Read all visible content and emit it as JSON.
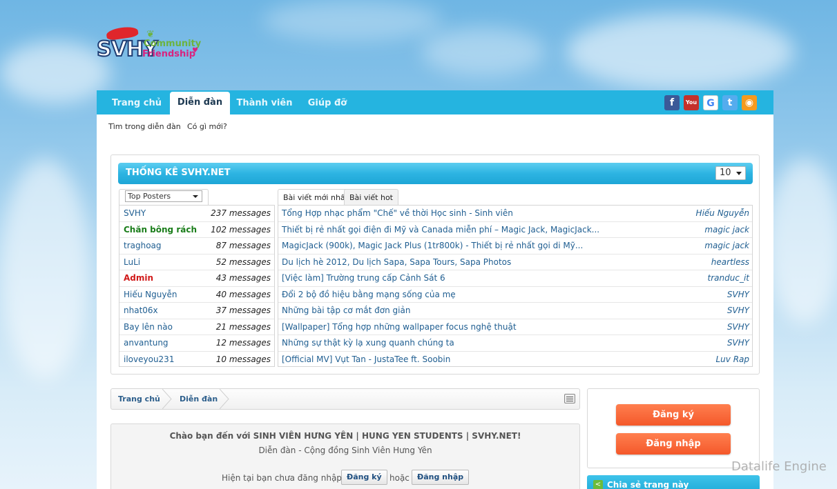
{
  "logo": {
    "text": "SVHY",
    "community": "Community",
    "friendship": "Friendship"
  },
  "nav": {
    "tabs": [
      {
        "label": "Trang chủ"
      },
      {
        "label": "Diễn đàn"
      },
      {
        "label": "Thành viên"
      },
      {
        "label": "Giúp đỡ"
      }
    ],
    "active_tab": "Diễn đàn",
    "social_icons": [
      "facebook-icon",
      "youtube-icon",
      "google-icon",
      "twitter-icon",
      "rss-icon"
    ]
  },
  "subnav": {
    "search": "Tìm trong diễn đàn",
    "whats_new": "Có gì mới?"
  },
  "stats": {
    "title": "THỐNG KÊ SVHY.NET",
    "count_value": "10",
    "poster_filter": "Top Posters",
    "posters": [
      {
        "name": "SVHY",
        "count": "237 messages",
        "style": "normal"
      },
      {
        "name": "Chăn bông rách",
        "count": "102 messages",
        "style": "green"
      },
      {
        "name": "traghoag",
        "count": "87 messages",
        "style": "normal"
      },
      {
        "name": "LuLi",
        "count": "52 messages",
        "style": "normal"
      },
      {
        "name": "Admin",
        "count": "43 messages",
        "style": "red"
      },
      {
        "name": "Hiếu Nguyễn",
        "count": "40 messages",
        "style": "normal"
      },
      {
        "name": "nhat06x",
        "count": "37 messages",
        "style": "normal"
      },
      {
        "name": "Bay lên nào",
        "count": "21 messages",
        "style": "normal"
      },
      {
        "name": "anvantung",
        "count": "12 messages",
        "style": "normal"
      },
      {
        "name": "iloveyou231",
        "count": "10 messages",
        "style": "normal"
      }
    ],
    "post_tabs": [
      {
        "label": "Bài viết mới nhất"
      },
      {
        "label": "Bài viết hot"
      }
    ],
    "posts": [
      {
        "title": "Tổng Hợp nhạc phẩm \"Chế\" về thời Học sinh - Sinh viên",
        "author": "Hiếu Nguyễn"
      },
      {
        "title": "Thiết bị rẻ nhất gọi điện đi Mỹ và Canada miễn phí – Magic Jack, MagicJack...",
        "author": "magic jack"
      },
      {
        "title": "MagicJack (900k), Magic Jack Plus (1tr800k) - Thiết bị rẻ nhất gọi di Mỹ...",
        "author": "magic jack"
      },
      {
        "title": "Du lịch hè 2012, Du lịch Sapa, Sapa Tours, Sapa Photos",
        "author": "heartless"
      },
      {
        "title": "[Việc làm] Trường trung cấp Cảnh Sát 6",
        "author": "tranduc_it"
      },
      {
        "title": "Đổi 2 bộ đồ hiệu bằng mạng sống của mẹ",
        "author": "SVHY"
      },
      {
        "title": "Những bài tập cơ mắt đơn giản",
        "author": "SVHY"
      },
      {
        "title": "[Wallpaper] Tổng hợp những wallpaper focus nghệ thuật",
        "author": "SVHY"
      },
      {
        "title": "Những sự thật kỳ lạ xung quanh chúng ta",
        "author": "SVHY"
      },
      {
        "title": "[Official MV] Vụt Tan - JustaTee ft. Soobin",
        "author": "Luv Rap"
      }
    ]
  },
  "breadcrumb": {
    "items": [
      "Trang chủ",
      "Diễn đàn"
    ]
  },
  "welcome": {
    "title": "Chào bạn đến với SINH VIÊN HƯNG YÊN | HUNG YEN STUDENTS | SVHY.NET!",
    "subtitle": "Diễn đàn - Cộng đồng Sinh Viên Hưng Yên",
    "status": "Hiện tại bạn chưa đăng nhập.",
    "register": "Đăng ký",
    "or": "hoặc",
    "login": "Đăng nhập"
  },
  "sidebar": {
    "register_button": "Đăng ký",
    "login_button": "Đăng nhập",
    "share_label": "Chia sẻ trang này"
  },
  "watermark": "Datalife Engine",
  "colors": {
    "nav_blue": "#25b4e0",
    "orange": "#f4582a",
    "link": "#1f5e91"
  }
}
